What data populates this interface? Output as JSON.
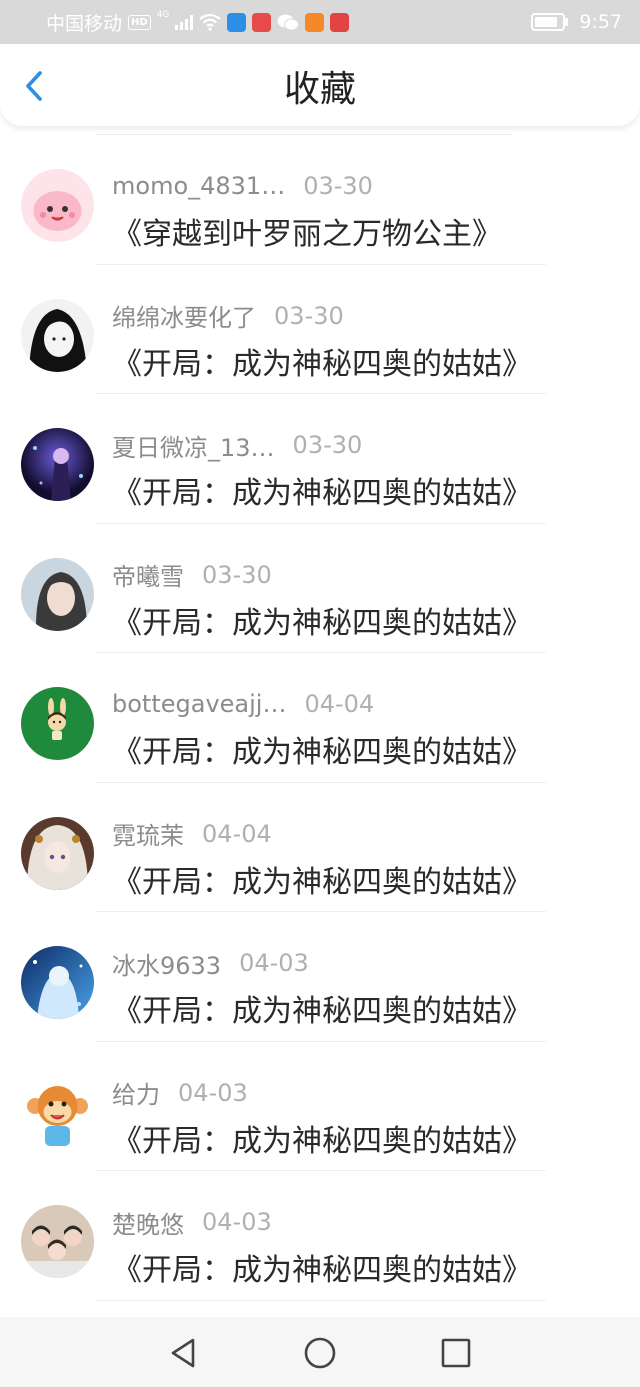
{
  "status_bar": {
    "carrier": "中国移动",
    "hd": "HD",
    "network": "4G",
    "time": "9:57",
    "battery_level": 0.85,
    "app_icons": [
      {
        "name": "wifi-share-app-icon",
        "color": "#2b8fe6"
      },
      {
        "name": "red-book-app-icon",
        "color": "#e84a4a"
      },
      {
        "name": "wechat-icon",
        "color": "#ffffff"
      },
      {
        "name": "orange-play-app-icon",
        "color": "#f5892a"
      },
      {
        "name": "red-heart-app-icon",
        "color": "#e24343"
      }
    ]
  },
  "header": {
    "title": "收藏",
    "back_icon": "chevron-left-icon",
    "accent_color": "#2e8fe0"
  },
  "favorites": [
    {
      "username": "momo_4831…",
      "date": "03-30",
      "book": "《穿越到叶罗丽之万物公主》"
    },
    {
      "username": "绵绵冰要化了",
      "date": "03-30",
      "book": "《开局：成为神秘四奥的姑姑》"
    },
    {
      "username": "夏日微凉_13…",
      "date": "03-30",
      "book": "《开局：成为神秘四奥的姑姑》"
    },
    {
      "username": "帝曦雪",
      "date": "03-30",
      "book": "《开局：成为神秘四奥的姑姑》"
    },
    {
      "username": "bottegaveajj…",
      "date": "04-04",
      "book": "《开局：成为神秘四奥的姑姑》"
    },
    {
      "username": "霓琉茉",
      "date": "04-04",
      "book": "《开局：成为神秘四奥的姑姑》"
    },
    {
      "username": "冰水9633",
      "date": "04-03",
      "book": "《开局：成为神秘四奥的姑姑》"
    },
    {
      "username": "给力",
      "date": "04-03",
      "book": "《开局：成为神秘四奥的姑姑》"
    },
    {
      "username": "楚晚悠",
      "date": "04-03",
      "book": "《开局：成为神秘四奥的姑姑》"
    }
  ],
  "nav_bar": {
    "back": "triangle-back-icon",
    "home": "circle-home-icon",
    "recents": "square-recents-icon"
  }
}
